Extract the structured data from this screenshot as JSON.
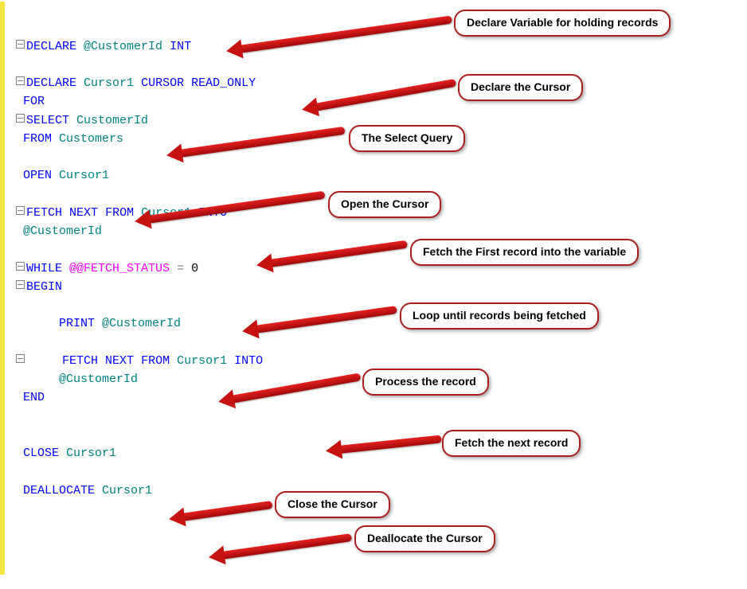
{
  "callouts": {
    "c1": "Declare Variable for holding records",
    "c2": "Declare the Cursor",
    "c3": "The Select Query",
    "c4": "Open the Cursor",
    "c5": "Fetch the First record into the variable",
    "c6": "Loop until records being fetched",
    "c7": "Process the record",
    "c8": "Fetch the next record",
    "c9": "Close the Cursor",
    "c10": "Deallocate the Cursor"
  },
  "code": {
    "l1": {
      "kw1": "DECLARE",
      "id1": "@CustomerId",
      "kw2": "INT"
    },
    "l2": {
      "kw1": "DECLARE",
      "id1": "Cursor1",
      "kw2": "CURSOR",
      "kw3": "READ_ONLY"
    },
    "l3": {
      "kw1": "FOR"
    },
    "l4": {
      "kw1": "SELECT",
      "id1": "CustomerId"
    },
    "l5": {
      "kw1": "FROM",
      "id1": "Customers"
    },
    "l6": {
      "kw1": "OPEN",
      "id1": "Cursor1"
    },
    "l7": {
      "kw1": "FETCH",
      "kw2": "NEXT",
      "kw3": "FROM",
      "id1": "Cursor1",
      "kw4": "INTO"
    },
    "l8": {
      "id1": "@CustomerId"
    },
    "l9": {
      "kw1": "WHILE",
      "sys": "@@FETCH_STATUS",
      "op": "=",
      "num": "0"
    },
    "l10": {
      "kw1": "BEGIN"
    },
    "l11": {
      "kw1": "PRINT",
      "id1": "@CustomerId"
    },
    "l12": {
      "kw1": "FETCH",
      "kw2": "NEXT",
      "kw3": "FROM",
      "id1": "Cursor1",
      "kw4": "INTO"
    },
    "l13": {
      "id1": "@CustomerId"
    },
    "l14": {
      "kw1": "END"
    },
    "l15": {
      "kw1": "CLOSE",
      "id1": "Cursor1"
    },
    "l16": {
      "kw1": "DEALLOCATE",
      "id1": "Cursor1"
    }
  }
}
